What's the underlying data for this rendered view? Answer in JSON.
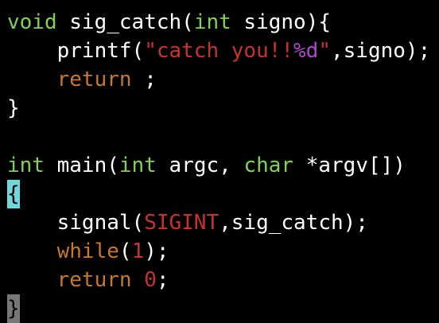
{
  "colors": {
    "background": "#000000",
    "plain": "#ffffff",
    "type": "#7fd35a",
    "keyword": "#c8782a",
    "string": "#c8322d",
    "format": "#b046c8",
    "constant": "#c8322d",
    "number": "#c8322d",
    "cursor_bg": "#6fd6dc",
    "cursor_fg": "#000000",
    "selection_bg": "#777777",
    "selection_fg": "#000000"
  },
  "editor": {
    "lines": [
      [
        {
          "t": "void",
          "s": "type"
        },
        {
          "t": " sig_catch(",
          "s": "plain"
        },
        {
          "t": "int",
          "s": "type"
        },
        {
          "t": " signo){",
          "s": "plain"
        }
      ],
      [
        {
          "t": "    printf(",
          "s": "plain"
        },
        {
          "t": "\"catch you!!",
          "s": "string"
        },
        {
          "t": "%d",
          "s": "format"
        },
        {
          "t": "\"",
          "s": "string"
        },
        {
          "t": ",signo);",
          "s": "plain"
        }
      ],
      [
        {
          "t": "    ",
          "s": "plain"
        },
        {
          "t": "return",
          "s": "keyword"
        },
        {
          "t": " ;",
          "s": "plain"
        }
      ],
      [
        {
          "t": "}",
          "s": "plain"
        }
      ],
      [],
      [
        {
          "t": "int",
          "s": "type"
        },
        {
          "t": " main(",
          "s": "plain"
        },
        {
          "t": "int",
          "s": "type"
        },
        {
          "t": " argc, ",
          "s": "plain"
        },
        {
          "t": "char",
          "s": "type"
        },
        {
          "t": " *argv[])",
          "s": "plain"
        }
      ],
      [
        {
          "t": "{",
          "s": "cursor"
        }
      ],
      [
        {
          "t": "    signal(",
          "s": "plain"
        },
        {
          "t": "SIGINT",
          "s": "constant"
        },
        {
          "t": ",sig_catch);",
          "s": "plain"
        }
      ],
      [
        {
          "t": "    ",
          "s": "plain"
        },
        {
          "t": "while",
          "s": "keyword"
        },
        {
          "t": "(",
          "s": "plain"
        },
        {
          "t": "1",
          "s": "number"
        },
        {
          "t": ");",
          "s": "plain"
        }
      ],
      [
        {
          "t": "    ",
          "s": "plain"
        },
        {
          "t": "return",
          "s": "keyword"
        },
        {
          "t": " ",
          "s": "plain"
        },
        {
          "t": "0",
          "s": "number"
        },
        {
          "t": ";",
          "s": "plain"
        }
      ],
      [
        {
          "t": "}",
          "s": "selection"
        }
      ]
    ]
  }
}
